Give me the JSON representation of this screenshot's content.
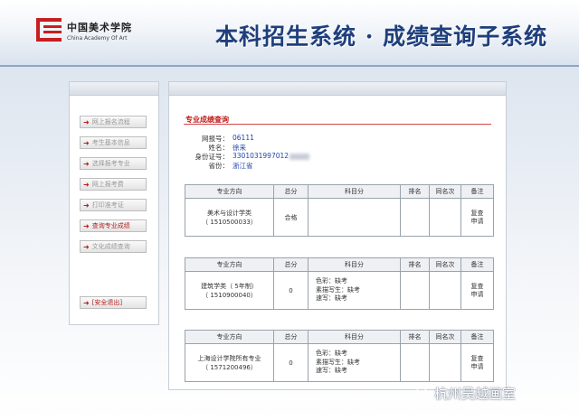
{
  "header": {
    "logo_cn": "中国美术学院",
    "logo_en": "China Academy Of Art",
    "title": "本科招生系统 · 成绩查询子系统"
  },
  "sidebar": {
    "items": [
      {
        "label": "网上报名流程",
        "active": false
      },
      {
        "label": "考生基本信息",
        "active": false
      },
      {
        "label": "选择报考专业",
        "active": false
      },
      {
        "label": "网上报考费",
        "active": false
      },
      {
        "label": "打印准考证",
        "active": false
      },
      {
        "label": "查询专业成绩",
        "active": true
      },
      {
        "label": "文化成绩查询",
        "active": false
      }
    ],
    "logout": "[安全退出]"
  },
  "main": {
    "section_title": "专业成绩查询",
    "info": [
      {
        "label": "网报号：",
        "value": "06111"
      },
      {
        "label": "姓名：",
        "value": "徐来"
      },
      {
        "label": "身份证号：",
        "value": "3301031997012"
      },
      {
        "label": "省份：",
        "value": "浙江省"
      }
    ],
    "columns": [
      "专业方向",
      "总分",
      "科目分",
      "排名",
      "同名次",
      "备注"
    ],
    "tables": [
      {
        "major": "美术与设计学类",
        "code": "（ 1510500033）",
        "total": "合格",
        "subjects": [],
        "rank": "",
        "same_rank": "",
        "remark_1": "复查",
        "remark_2": "申请"
      },
      {
        "major": "建筑学类（ 5年制）",
        "code": "（ 1510900040）",
        "total": "0",
        "subjects": [
          "色彩：缺考",
          "素描写生：缺考",
          "速写：缺考"
        ],
        "rank": "",
        "same_rank": "",
        "remark_1": "复查",
        "remark_2": "申请"
      },
      {
        "major": "上海设计学院所有专业",
        "code": "（ 1571200496）",
        "total": "0",
        "subjects": [
          "色彩：缺考",
          "素描写生：缺考",
          "速写：缺考"
        ],
        "rank": "",
        "same_rank": "",
        "remark_1": "复查",
        "remark_2": "申请"
      }
    ]
  },
  "watermark": "杭州吴越画室",
  "colors": {
    "accent_red": "#c81e1e",
    "title_blue": "#1f3f7c",
    "link_blue": "#2244aa"
  }
}
